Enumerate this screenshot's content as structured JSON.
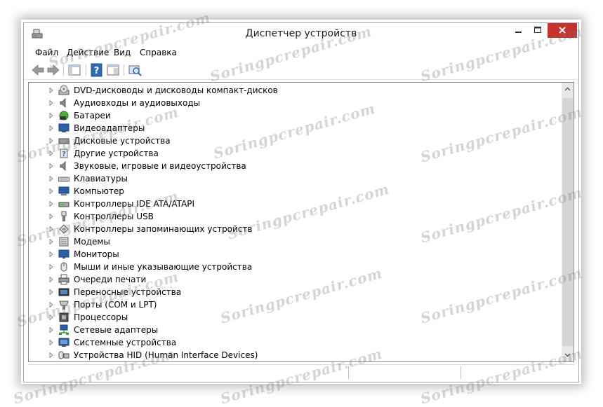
{
  "window": {
    "title": "Диспетчер устройств"
  },
  "menu": {
    "items": [
      "Файл",
      "Действие",
      "Вид",
      "Справка"
    ]
  },
  "tree": {
    "items": [
      {
        "label": "DVD-дисководы и дисководы компакт-дисков",
        "icon": "dvd-drive-icon"
      },
      {
        "label": "Аудиовходы и аудиовыходы",
        "icon": "speaker-icon"
      },
      {
        "label": "Батареи",
        "icon": "battery-icon"
      },
      {
        "label": "Видеоадаптеры",
        "icon": "display-adapter-icon"
      },
      {
        "label": "Дисковые устройства",
        "icon": "disk-drive-icon"
      },
      {
        "label": "Другие устройства",
        "icon": "unknown-device-icon"
      },
      {
        "label": "Звуковые, игровые и видеоустройства",
        "icon": "sound-icon"
      },
      {
        "label": "Клавиатуры",
        "icon": "keyboard-icon"
      },
      {
        "label": "Компьютер",
        "icon": "computer-icon"
      },
      {
        "label": "Контроллеры IDE ATA/ATAPI",
        "icon": "ide-controller-icon"
      },
      {
        "label": "Контроллеры USB",
        "icon": "usb-icon"
      },
      {
        "label": "Контроллеры запоминающих устройств",
        "icon": "storage-controller-icon"
      },
      {
        "label": "Модемы",
        "icon": "modem-icon"
      },
      {
        "label": "Мониторы",
        "icon": "monitor-icon"
      },
      {
        "label": "Мыши и иные указывающие устройства",
        "icon": "mouse-icon"
      },
      {
        "label": "Очереди печати",
        "icon": "printer-icon"
      },
      {
        "label": "Переносные устройства",
        "icon": "portable-device-icon"
      },
      {
        "label": "Порты (COM и LPT)",
        "icon": "port-icon"
      },
      {
        "label": "Процессоры",
        "icon": "processor-icon"
      },
      {
        "label": "Сетевые адаптеры",
        "icon": "network-adapter-icon"
      },
      {
        "label": "Системные устройства",
        "icon": "system-device-icon"
      },
      {
        "label": "Устройства HID (Human Interface Devices)",
        "icon": "hid-icon"
      }
    ]
  },
  "watermark": {
    "text": "Soringpcrepair.com"
  },
  "colors": {
    "close_button": "#c7312e",
    "accent": "#2d6cb5"
  }
}
